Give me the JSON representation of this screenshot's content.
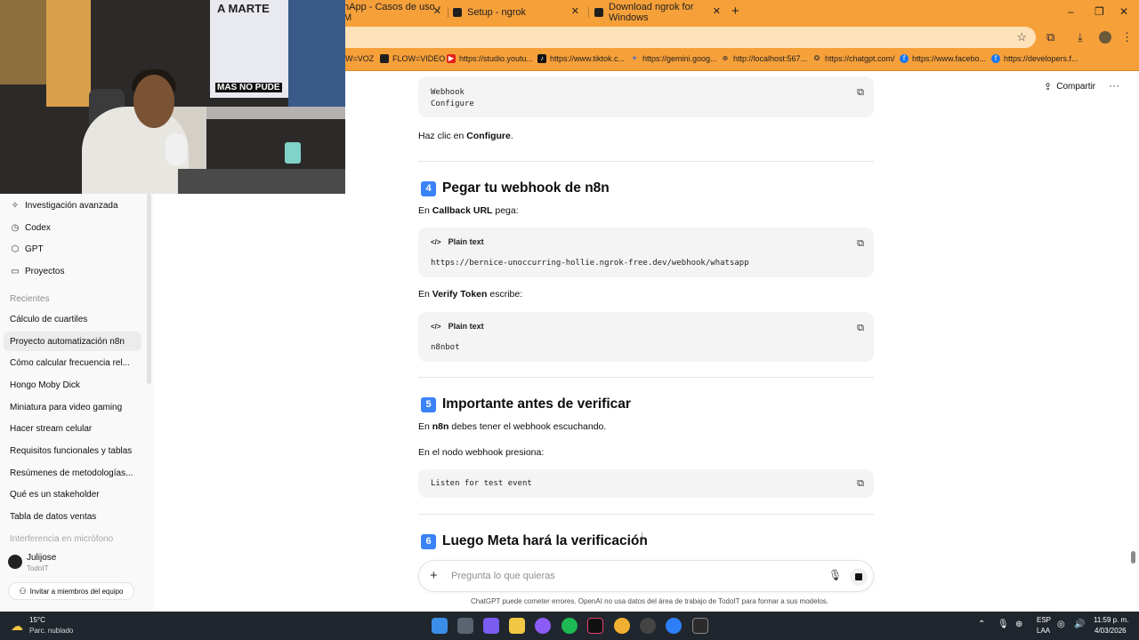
{
  "browser": {
    "tabs": [
      {
        "title": "hApp - Casos de uso - M"
      },
      {
        "title": "Setup - ngrok"
      },
      {
        "title": "Download ngrok for Windows"
      }
    ],
    "tab_close_glyph": "✕",
    "new_tab_glyph": "+",
    "window_controls": [
      "–",
      "❐",
      "✕"
    ],
    "bookmarks": [
      {
        "label": "W=VOZ"
      },
      {
        "label": "FLOW=VIDEO"
      },
      {
        "label": "https://studio.youtu..."
      },
      {
        "label": "https://www.tiktok.c..."
      },
      {
        "label": "https://gemini.goog..."
      },
      {
        "label": "http://localhost:567..."
      },
      {
        "label": "https://chatgpt.com/"
      },
      {
        "label": "https://www.facebo..."
      },
      {
        "label": "https://developers.f..."
      }
    ],
    "accent_color": "#f6a03a"
  },
  "webcam": {
    "poster_top": "A MARTE",
    "poster_bottom": "MAS NO PUDE"
  },
  "sidebar": {
    "nav": [
      {
        "label": "Investigación avanzada",
        "icon": "telescope-icon",
        "glyph": "✧"
      },
      {
        "label": "Codex",
        "icon": "codex-icon",
        "glyph": "◷"
      },
      {
        "label": "GPT",
        "icon": "gpt-icon",
        "glyph": "⬡"
      },
      {
        "label": "Proyectos",
        "icon": "folder-icon",
        "glyph": "▭"
      }
    ],
    "recents_header": "Recientes",
    "recents": [
      "Cálculo de cuartiles",
      "Proyecto automatización n8n",
      "Cómo calcular frecuencia rel...",
      "Hongo Moby Dick",
      "Miniatura para video gaming",
      "Hacer stream celular",
      "Requisitos funcionales y tablas",
      "Resúmenes de metodologías...",
      "Qué es un stakeholder",
      "Tabla de datos ventas",
      "Interferencia en micrófono"
    ],
    "user_name": "Julijose",
    "user_org": "TodoIT",
    "invite_label": "Invitar a miembros del equipo"
  },
  "header": {
    "share_label": "Compartir",
    "more_glyph": "···"
  },
  "content": {
    "code1_line1": "Webhook",
    "code1_line2": "Configure",
    "p1_pre": "Haz clic en ",
    "p1_bold": "Configure",
    "p1_post": ".",
    "h4_num": "4",
    "h4_title": "Pegar tu webhook de n8n",
    "p2_pre": "En ",
    "p2_bold": "Callback URL",
    "p2_post": " pega:",
    "code_label": "Plain text",
    "code2_line": "https://bernice-unoccurring-hollie.ngrok-free.dev/webhook/whatsapp",
    "p3_pre": "En ",
    "p3_bold": "Verify Token",
    "p3_post": " escribe:",
    "code3_line": "n8nbot",
    "h5_num": "5",
    "h5_title": "Importante antes de verificar",
    "p4_pre": "En ",
    "p4_bold": "n8n",
    "p4_post": " debes tener el webhook escuchando.",
    "p5": "En el nodo webhook presiona:",
    "code4_line": "Listen for test event",
    "h6_num": "6",
    "h6_title": "Luego Meta hará la verificación"
  },
  "composer": {
    "placeholder": "Pregunta lo que quieras",
    "disclaimer": "ChatGPT puede cometer errores. OpenAI no usa datos del área de trabajo de TodoIT para formar a sus modelos."
  },
  "taskbar": {
    "temp": "15°C",
    "weather": "Parc. nublado",
    "lang1": "ESP",
    "lang2": "LAA",
    "time": "11:59 p. m.",
    "date": "4/03/2026"
  }
}
